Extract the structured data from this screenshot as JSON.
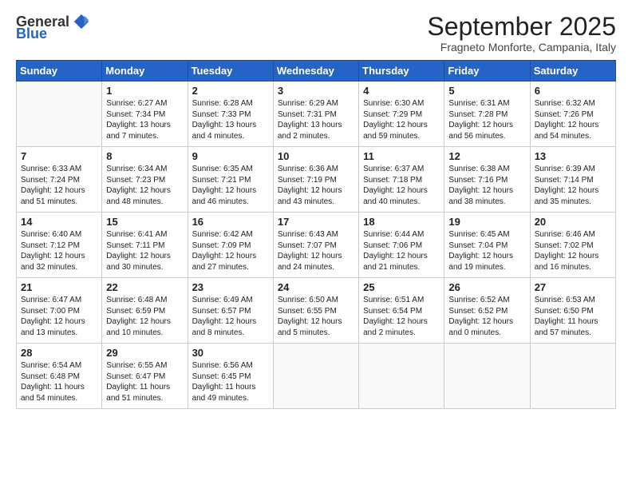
{
  "logo": {
    "general": "General",
    "blue": "Blue"
  },
  "title": "September 2025",
  "subtitle": "Fragneto Monforte, Campania, Italy",
  "days_of_week": [
    "Sunday",
    "Monday",
    "Tuesday",
    "Wednesday",
    "Thursday",
    "Friday",
    "Saturday"
  ],
  "weeks": [
    [
      {
        "day": "",
        "text": ""
      },
      {
        "day": "1",
        "text": "Sunrise: 6:27 AM\nSunset: 7:34 PM\nDaylight: 13 hours\nand 7 minutes."
      },
      {
        "day": "2",
        "text": "Sunrise: 6:28 AM\nSunset: 7:33 PM\nDaylight: 13 hours\nand 4 minutes."
      },
      {
        "day": "3",
        "text": "Sunrise: 6:29 AM\nSunset: 7:31 PM\nDaylight: 13 hours\nand 2 minutes."
      },
      {
        "day": "4",
        "text": "Sunrise: 6:30 AM\nSunset: 7:29 PM\nDaylight: 12 hours\nand 59 minutes."
      },
      {
        "day": "5",
        "text": "Sunrise: 6:31 AM\nSunset: 7:28 PM\nDaylight: 12 hours\nand 56 minutes."
      },
      {
        "day": "6",
        "text": "Sunrise: 6:32 AM\nSunset: 7:26 PM\nDaylight: 12 hours\nand 54 minutes."
      }
    ],
    [
      {
        "day": "7",
        "text": "Sunrise: 6:33 AM\nSunset: 7:24 PM\nDaylight: 12 hours\nand 51 minutes."
      },
      {
        "day": "8",
        "text": "Sunrise: 6:34 AM\nSunset: 7:23 PM\nDaylight: 12 hours\nand 48 minutes."
      },
      {
        "day": "9",
        "text": "Sunrise: 6:35 AM\nSunset: 7:21 PM\nDaylight: 12 hours\nand 46 minutes."
      },
      {
        "day": "10",
        "text": "Sunrise: 6:36 AM\nSunset: 7:19 PM\nDaylight: 12 hours\nand 43 minutes."
      },
      {
        "day": "11",
        "text": "Sunrise: 6:37 AM\nSunset: 7:18 PM\nDaylight: 12 hours\nand 40 minutes."
      },
      {
        "day": "12",
        "text": "Sunrise: 6:38 AM\nSunset: 7:16 PM\nDaylight: 12 hours\nand 38 minutes."
      },
      {
        "day": "13",
        "text": "Sunrise: 6:39 AM\nSunset: 7:14 PM\nDaylight: 12 hours\nand 35 minutes."
      }
    ],
    [
      {
        "day": "14",
        "text": "Sunrise: 6:40 AM\nSunset: 7:12 PM\nDaylight: 12 hours\nand 32 minutes."
      },
      {
        "day": "15",
        "text": "Sunrise: 6:41 AM\nSunset: 7:11 PM\nDaylight: 12 hours\nand 30 minutes."
      },
      {
        "day": "16",
        "text": "Sunrise: 6:42 AM\nSunset: 7:09 PM\nDaylight: 12 hours\nand 27 minutes."
      },
      {
        "day": "17",
        "text": "Sunrise: 6:43 AM\nSunset: 7:07 PM\nDaylight: 12 hours\nand 24 minutes."
      },
      {
        "day": "18",
        "text": "Sunrise: 6:44 AM\nSunset: 7:06 PM\nDaylight: 12 hours\nand 21 minutes."
      },
      {
        "day": "19",
        "text": "Sunrise: 6:45 AM\nSunset: 7:04 PM\nDaylight: 12 hours\nand 19 minutes."
      },
      {
        "day": "20",
        "text": "Sunrise: 6:46 AM\nSunset: 7:02 PM\nDaylight: 12 hours\nand 16 minutes."
      }
    ],
    [
      {
        "day": "21",
        "text": "Sunrise: 6:47 AM\nSunset: 7:00 PM\nDaylight: 12 hours\nand 13 minutes."
      },
      {
        "day": "22",
        "text": "Sunrise: 6:48 AM\nSunset: 6:59 PM\nDaylight: 12 hours\nand 10 minutes."
      },
      {
        "day": "23",
        "text": "Sunrise: 6:49 AM\nSunset: 6:57 PM\nDaylight: 12 hours\nand 8 minutes."
      },
      {
        "day": "24",
        "text": "Sunrise: 6:50 AM\nSunset: 6:55 PM\nDaylight: 12 hours\nand 5 minutes."
      },
      {
        "day": "25",
        "text": "Sunrise: 6:51 AM\nSunset: 6:54 PM\nDaylight: 12 hours\nand 2 minutes."
      },
      {
        "day": "26",
        "text": "Sunrise: 6:52 AM\nSunset: 6:52 PM\nDaylight: 12 hours\nand 0 minutes."
      },
      {
        "day": "27",
        "text": "Sunrise: 6:53 AM\nSunset: 6:50 PM\nDaylight: 11 hours\nand 57 minutes."
      }
    ],
    [
      {
        "day": "28",
        "text": "Sunrise: 6:54 AM\nSunset: 6:48 PM\nDaylight: 11 hours\nand 54 minutes."
      },
      {
        "day": "29",
        "text": "Sunrise: 6:55 AM\nSunset: 6:47 PM\nDaylight: 11 hours\nand 51 minutes."
      },
      {
        "day": "30",
        "text": "Sunrise: 6:56 AM\nSunset: 6:45 PM\nDaylight: 11 hours\nand 49 minutes."
      },
      {
        "day": "",
        "text": ""
      },
      {
        "day": "",
        "text": ""
      },
      {
        "day": "",
        "text": ""
      },
      {
        "day": "",
        "text": ""
      }
    ]
  ]
}
